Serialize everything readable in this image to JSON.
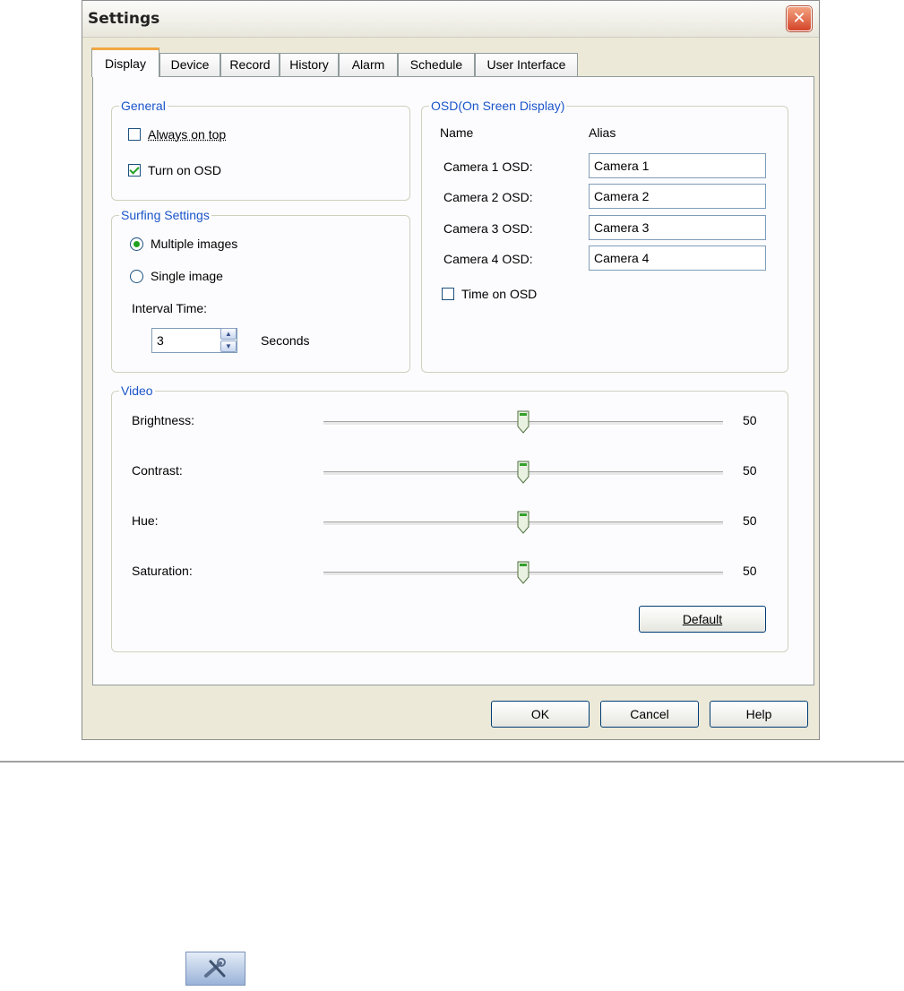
{
  "window": {
    "title": "Settings",
    "close_glyph": "✕"
  },
  "tabs": [
    {
      "label": "Display"
    },
    {
      "label": "Device"
    },
    {
      "label": "Record"
    },
    {
      "label": "History"
    },
    {
      "label": "Alarm"
    },
    {
      "label": "Schedule"
    },
    {
      "label": "User Interface"
    }
  ],
  "general": {
    "legend": "General",
    "always_on_top": {
      "label": "Always on top",
      "checked": false
    },
    "turn_on_osd": {
      "label": "Turn on OSD",
      "checked": true
    }
  },
  "surfing": {
    "legend": "Surfing Settings",
    "multiple": {
      "label": "Multiple images",
      "selected": true
    },
    "single": {
      "label": "Single image",
      "selected": false
    },
    "interval_label": "Interval Time:",
    "interval_value": "3",
    "interval_unit": "Seconds"
  },
  "osd": {
    "legend": "OSD(On Sreen Display)",
    "name_header": "Name",
    "alias_header": "Alias",
    "cameras": [
      {
        "name": "Camera 1 OSD:",
        "alias": "Camera 1"
      },
      {
        "name": "Camera 2 OSD:",
        "alias": "Camera 2"
      },
      {
        "name": "Camera 3 OSD:",
        "alias": "Camera 3"
      },
      {
        "name": "Camera 4 OSD:",
        "alias": "Camera 4"
      }
    ],
    "time_on_osd": {
      "label": "Time on OSD",
      "checked": false
    }
  },
  "video": {
    "legend": "Video",
    "sliders": [
      {
        "label": "Brightness:",
        "value": 50,
        "max": 100,
        "value_text": "50"
      },
      {
        "label": "Contrast:",
        "value": 50,
        "max": 100,
        "value_text": "50"
      },
      {
        "label": "Hue:",
        "value": 50,
        "max": 100,
        "value_text": "50"
      },
      {
        "label": "Saturation:",
        "value": 50,
        "max": 100,
        "value_text": "50"
      }
    ],
    "default_label": "Default"
  },
  "buttons": {
    "ok": "OK",
    "cancel": "Cancel",
    "help": "Help"
  },
  "colors": {
    "accent": "#f2a742",
    "legend_text": "#1b55c9",
    "check": "#21a121"
  }
}
